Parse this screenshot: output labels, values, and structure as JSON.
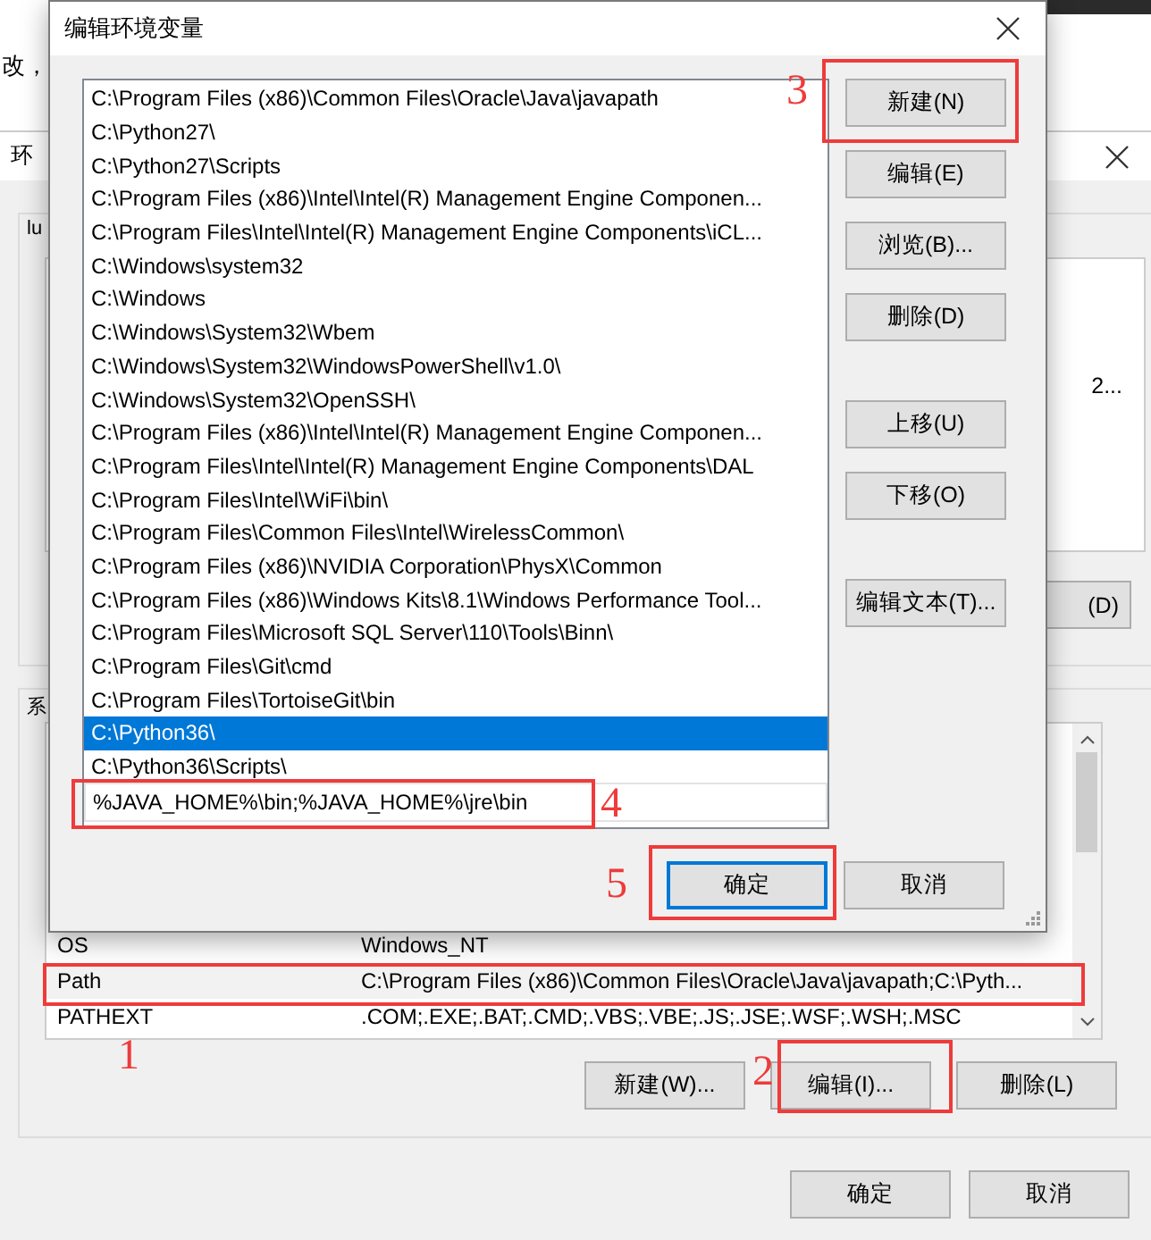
{
  "back_window_fragment": {
    "text": "改，"
  },
  "env_window": {
    "title": "环",
    "user_group": {
      "label": "lu",
      "value_fragment": "2...",
      "button_fragment": "(D)"
    },
    "system_group": {
      "label": "系",
      "variables": [
        {
          "name": "OS",
          "value": "Windows_NT",
          "selected": false
        },
        {
          "name": "Path",
          "value": "C:\\Program Files (x86)\\Common Files\\Oracle\\Java\\javapath;C:\\Pyth...",
          "selected": true
        },
        {
          "name": "PATHEXT",
          "value": ".COM;.EXE;.BAT;.CMD;.VBS;.VBE;.JS;.JSE;.WSF;.WSH;.MSC",
          "selected": false
        }
      ],
      "buttons": [
        "新建(W)...",
        "编辑(I)...",
        "删除(L)"
      ]
    },
    "buttons": [
      "确定",
      "取消"
    ]
  },
  "edit_dialog": {
    "title": "编辑环境变量",
    "paths": [
      {
        "kind": "path",
        "text": "C:\\Program Files (x86)\\Common Files\\Oracle\\Java\\javapath",
        "selected": false
      },
      {
        "kind": "path",
        "text": "C:\\Python27\\",
        "selected": false
      },
      {
        "kind": "path",
        "text": "C:\\Python27\\Scripts",
        "selected": false
      },
      {
        "kind": "path",
        "text": "C:\\Program Files (x86)\\Intel\\Intel(R) Management Engine Componen...",
        "selected": false
      },
      {
        "kind": "path",
        "text": "C:\\Program Files\\Intel\\Intel(R) Management Engine Components\\iCL...",
        "selected": false
      },
      {
        "kind": "path",
        "text": "C:\\Windows\\system32",
        "selected": false
      },
      {
        "kind": "path",
        "text": "C:\\Windows",
        "selected": false
      },
      {
        "kind": "path",
        "text": "C:\\Windows\\System32\\Wbem",
        "selected": false
      },
      {
        "kind": "path",
        "text": "C:\\Windows\\System32\\WindowsPowerShell\\v1.0\\",
        "selected": false
      },
      {
        "kind": "path",
        "text": "C:\\Windows\\System32\\OpenSSH\\",
        "selected": false
      },
      {
        "kind": "path",
        "text": "C:\\Program Files (x86)\\Intel\\Intel(R) Management Engine Componen...",
        "selected": false
      },
      {
        "kind": "path",
        "text": "C:\\Program Files\\Intel\\Intel(R) Management Engine Components\\DAL",
        "selected": false
      },
      {
        "kind": "path",
        "text": "C:\\Program Files\\Intel\\WiFi\\bin\\",
        "selected": false
      },
      {
        "kind": "path",
        "text": "C:\\Program Files\\Common Files\\Intel\\WirelessCommon\\",
        "selected": false
      },
      {
        "kind": "path",
        "text": "C:\\Program Files (x86)\\NVIDIA Corporation\\PhysX\\Common",
        "selected": false
      },
      {
        "kind": "path",
        "text": "C:\\Program Files (x86)\\Windows Kits\\8.1\\Windows Performance Tool...",
        "selected": false
      },
      {
        "kind": "path",
        "text": "C:\\Program Files\\Microsoft SQL Server\\110\\Tools\\Binn\\",
        "selected": false
      },
      {
        "kind": "path",
        "text": "C:\\Program Files\\Git\\cmd",
        "selected": false
      },
      {
        "kind": "path",
        "text": "C:\\Program Files\\TortoiseGit\\bin",
        "selected": false
      },
      {
        "kind": "path",
        "text": "C:\\Python36\\",
        "selected": true
      },
      {
        "kind": "path",
        "text": "C:\\Python36\\Scripts\\",
        "selected": false
      },
      {
        "kind": "input",
        "text": "%JAVA_HOME%\\bin;%JAVA_HOME%\\jre\\bin",
        "selected": false
      }
    ],
    "side_buttons": [
      "新建(N)",
      "编辑(E)",
      "浏览(B)...",
      "删除(D)",
      "上移(U)",
      "下移(O)",
      "编辑文本(T)..."
    ],
    "buttons": [
      {
        "label": "确定",
        "focused": true
      },
      {
        "label": "取消",
        "focused": false
      }
    ]
  },
  "annotations": [
    {
      "label": "3"
    },
    {
      "label": "4"
    },
    {
      "label": "5"
    },
    {
      "label": "1"
    },
    {
      "label": "2"
    }
  ]
}
